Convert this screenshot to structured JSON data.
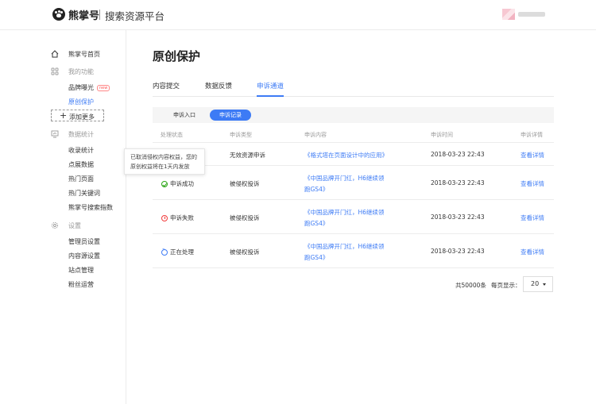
{
  "header": {
    "brand": "熊掌号",
    "platform_title": "搜索资源平台"
  },
  "sidebar": {
    "home": "熊掌号首页",
    "my_functions": "我的功能",
    "brand_exposure": "品牌曝光",
    "new_badge": "new",
    "original_protection": "原创保护",
    "add_more": "添加更多",
    "data_stats": "数据统计",
    "traffic_stats": "收录统计",
    "click_data": "点展数据",
    "hot_pages": "热门页面",
    "hot_keywords": "热门关键词",
    "search_index": "熊掌号搜索指数",
    "settings": "设置",
    "admin_settings": "管理员设置",
    "content_source": "内容源设置",
    "site_management": "站点管理",
    "fans_ops": "粉丝运营"
  },
  "main": {
    "title": "原创保护",
    "tabs": [
      "内容提交",
      "数据反馈",
      "申诉通道"
    ],
    "subtabs": [
      "申诉入口",
      "申诉记录"
    ],
    "columns": [
      "处理状态",
      "申诉类型",
      "申诉内容",
      "申诉时间",
      "申诉详情"
    ],
    "rows": [
      {
        "status": "",
        "type": "无效资源申诉",
        "content_line1": "《格式塔在页面设计中的应用》",
        "content_line2": "",
        "time": "2018-03-23  22:43",
        "detail": "查看详情"
      },
      {
        "status": "申诉成功",
        "type": "被侵权投诉",
        "content_line1": "《中国品牌开门红，H6继续领",
        "content_line2": "跑GS4》",
        "time": "2018-03-23  22:43",
        "detail": "查看详情"
      },
      {
        "status": "申诉失败",
        "type": "被侵权投诉",
        "content_line1": "《中国品牌开门红，H6继续领",
        "content_line2": "跑GS4》",
        "time": "2018-03-23  22:43",
        "detail": "查看详情"
      },
      {
        "status": "正在处理",
        "type": "被侵权投诉",
        "content_line1": "《中国品牌开门红，H6继续领",
        "content_line2": "跑GS4》",
        "time": "2018-03-23  22:43",
        "detail": "查看详情"
      }
    ],
    "tooltip_line1": "已取消侵权内容权益，您的",
    "tooltip_line2": "原创权益将在1天内发放",
    "total": "共50000条",
    "per_page_label": "每页显示：",
    "per_page_value": "20"
  },
  "colors": {
    "accent": "#3d7bf5",
    "success": "#2aa515",
    "fail": "#f23c3c"
  }
}
